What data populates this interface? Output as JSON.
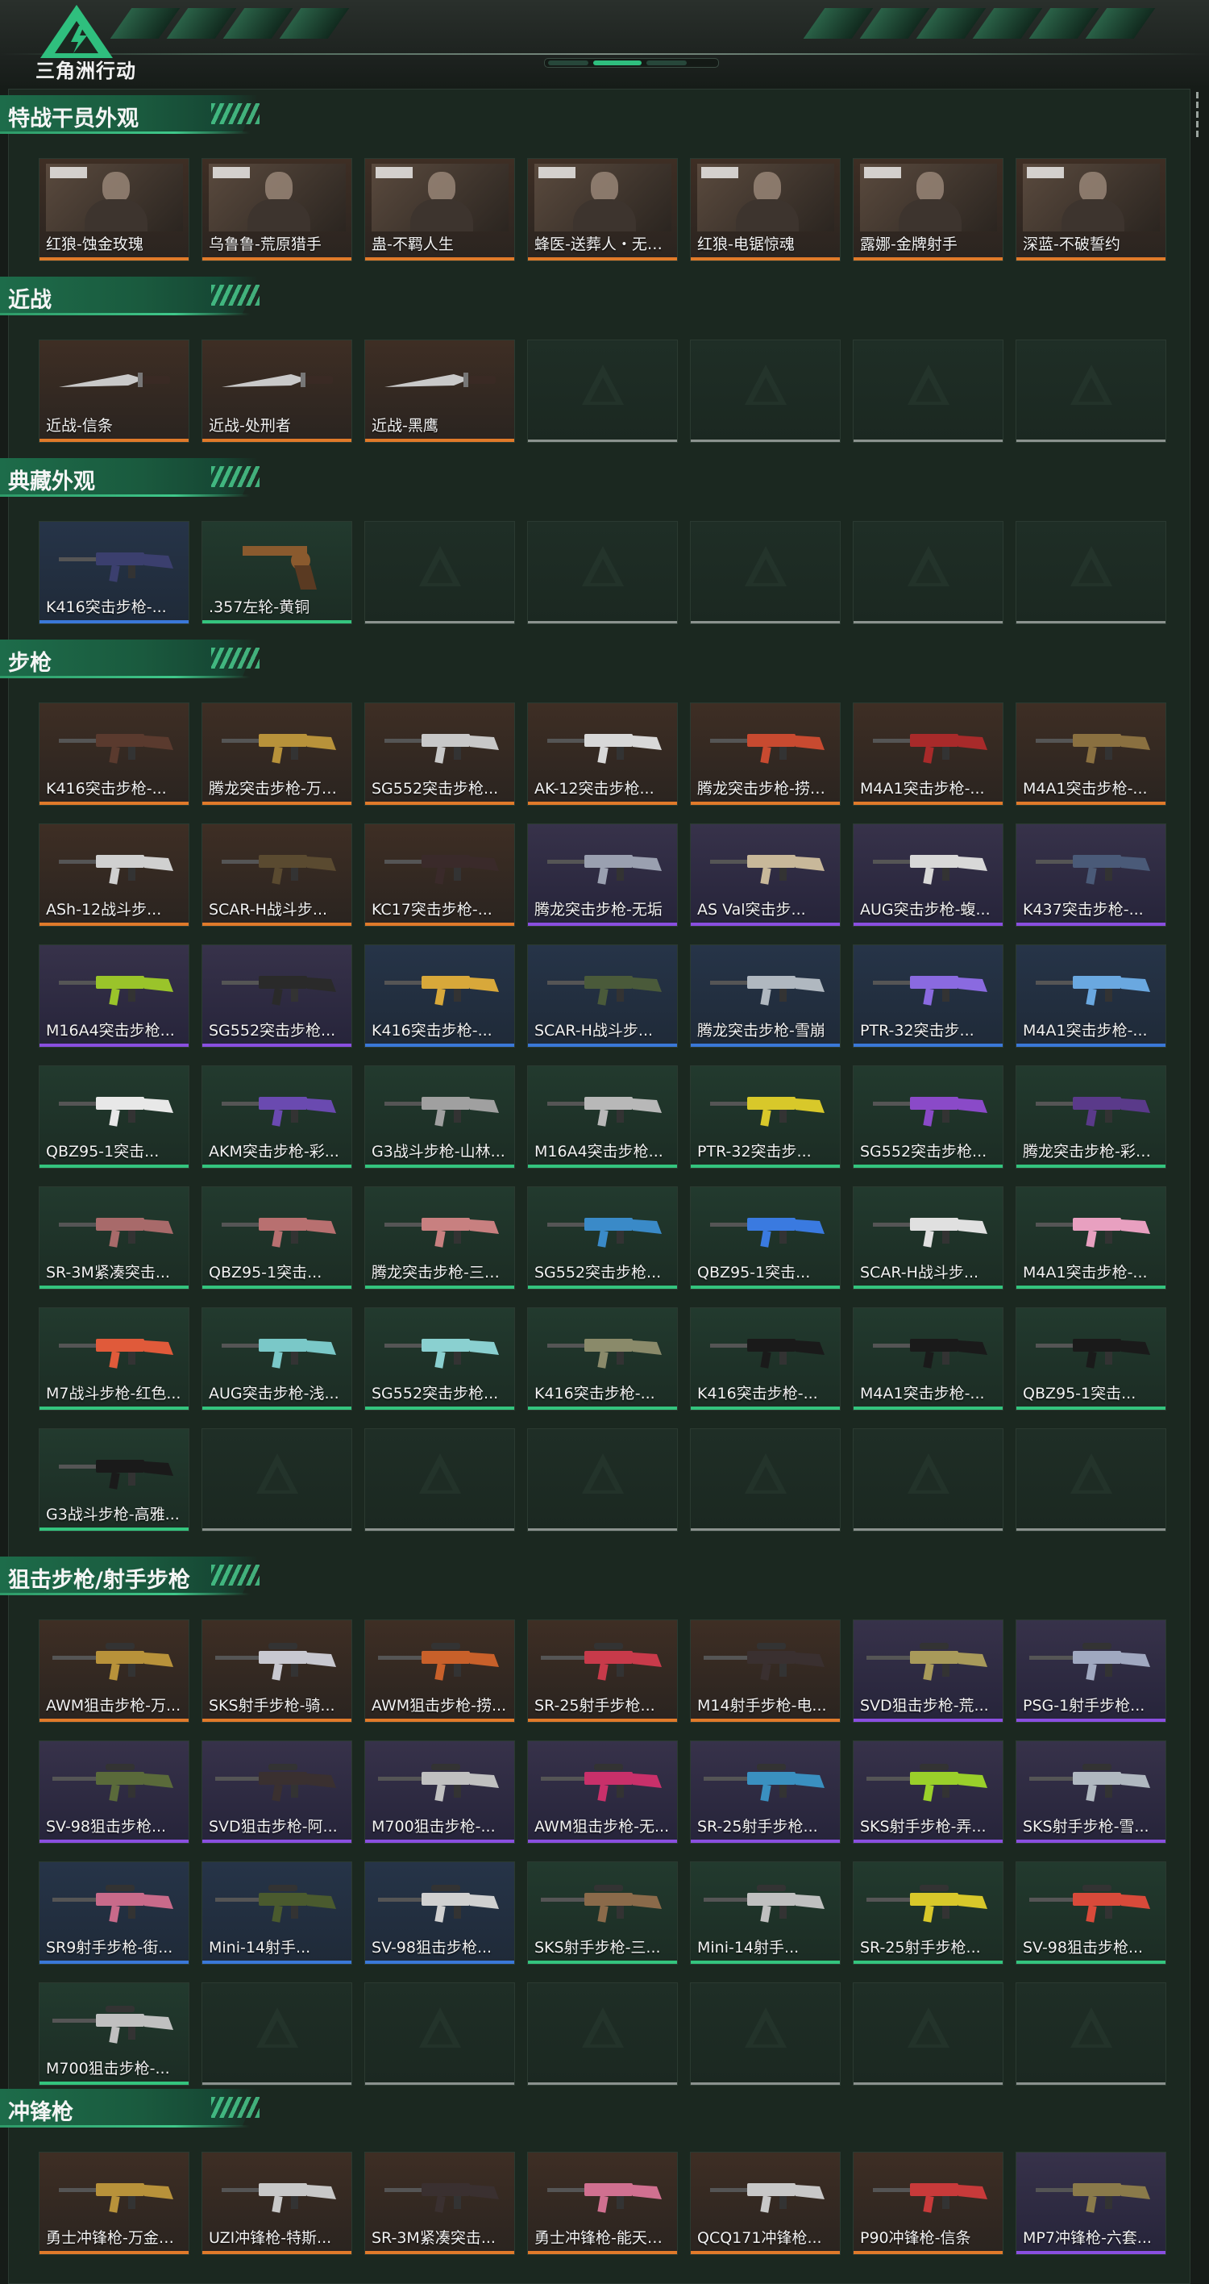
{
  "header": {
    "logo_text": "三角洲行动"
  },
  "colors": {
    "background": "#161c18",
    "panel": "#1b2820",
    "accent_green": "#2fbf7e",
    "quality_orange": "#e07a2a",
    "quality_purple": "#8a4fe0",
    "quality_blue": "#3a78d8",
    "quality_green": "#34c47e",
    "quality_empty": "#8b928e"
  },
  "sections": [
    {
      "title": "特战干员外观",
      "rows": [
        [
          {
            "label": "红狼-蚀金玫瑰",
            "quality": "orange",
            "kind": "operator"
          },
          {
            "label": "乌鲁鲁-荒原猎手",
            "quality": "orange",
            "kind": "operator"
          },
          {
            "label": "蛊-不羁人生",
            "quality": "orange",
            "kind": "operator"
          },
          {
            "label": "蜂医-送葬人・无题...",
            "quality": "orange",
            "kind": "operator"
          },
          {
            "label": "红狼-电锯惊魂",
            "quality": "orange",
            "kind": "operator"
          },
          {
            "label": "露娜-金牌射手",
            "quality": "orange",
            "kind": "operator"
          },
          {
            "label": "深蓝-不破誓约",
            "quality": "orange",
            "kind": "operator"
          }
        ]
      ]
    },
    {
      "title": "近战",
      "rows": [
        [
          {
            "label": "近战-信条",
            "quality": "orange",
            "kind": "melee"
          },
          {
            "label": "近战-处刑者",
            "quality": "orange",
            "kind": "melee"
          },
          {
            "label": "近战-黑鹰",
            "quality": "orange",
            "kind": "melee"
          },
          {
            "label": "",
            "quality": "empty",
            "kind": "empty"
          },
          {
            "label": "",
            "quality": "empty",
            "kind": "empty"
          },
          {
            "label": "",
            "quality": "empty",
            "kind": "empty"
          },
          {
            "label": "",
            "quality": "empty",
            "kind": "empty"
          }
        ]
      ]
    },
    {
      "title": "典藏外观",
      "rows": [
        [
          {
            "label": "K416突击步枪-...",
            "quality": "blue",
            "kind": "rifle",
            "gun_color": "#3b3f6e"
          },
          {
            "label": ".357左轮-黄铜",
            "quality": "green",
            "kind": "pistol",
            "gun_color": "#8a5a2e"
          },
          {
            "label": "",
            "quality": "empty",
            "kind": "empty"
          },
          {
            "label": "",
            "quality": "empty",
            "kind": "empty"
          },
          {
            "label": "",
            "quality": "empty",
            "kind": "empty"
          },
          {
            "label": "",
            "quality": "empty",
            "kind": "empty"
          },
          {
            "label": "",
            "quality": "empty",
            "kind": "empty"
          }
        ]
      ]
    },
    {
      "title": "步枪",
      "rows": [
        [
          {
            "label": "K416突击步枪-...",
            "quality": "orange",
            "kind": "rifle",
            "gun_color": "#5a3a2e"
          },
          {
            "label": "腾龙突击步枪-万金...",
            "quality": "orange",
            "kind": "rifle",
            "gun_color": "#b8923a"
          },
          {
            "label": "SG552突击步枪...",
            "quality": "orange",
            "kind": "rifle",
            "gun_color": "#c8c8c8"
          },
          {
            "label": "AK-12突击步枪...",
            "quality": "orange",
            "kind": "rifle",
            "gun_color": "#d8d8d8"
          },
          {
            "label": "腾龙突击步枪-捞点...",
            "quality": "orange",
            "kind": "rifle",
            "gun_color": "#c84a30"
          },
          {
            "label": "M4A1突击步枪-...",
            "quality": "orange",
            "kind": "rifle",
            "gun_color": "#a82a2a"
          },
          {
            "label": "M4A1突击步枪-...",
            "quality": "orange",
            "kind": "rifle",
            "gun_color": "#8a7040"
          }
        ],
        [
          {
            "label": "ASh-12战斗步...",
            "quality": "orange",
            "kind": "rifle",
            "gun_color": "#d0d0d0"
          },
          {
            "label": "SCAR-H战斗步...",
            "quality": "orange",
            "kind": "rifle",
            "gun_color": "#5a4a30"
          },
          {
            "label": "KC17突击步枪-...",
            "quality": "orange",
            "kind": "rifle",
            "gun_color": "#3a2a2a"
          },
          {
            "label": "腾龙突击步枪-无垢",
            "quality": "purple",
            "kind": "rifle",
            "gun_color": "#9aa0b0"
          },
          {
            "label": "AS Val突击步...",
            "quality": "purple",
            "kind": "rifle",
            "gun_color": "#c8b89a"
          },
          {
            "label": "AUG突击步枪-蝮...",
            "quality": "purple",
            "kind": "rifle",
            "gun_color": "#d8d8d8"
          },
          {
            "label": "K437突击步枪-...",
            "quality": "purple",
            "kind": "rifle",
            "gun_color": "#4a5a78"
          }
        ],
        [
          {
            "label": "M16A4突击步枪...",
            "quality": "purple",
            "kind": "rifle",
            "gun_color": "#9ac42a"
          },
          {
            "label": "SG552突击步枪...",
            "quality": "purple",
            "kind": "rifle",
            "gun_color": "#2a2a2a"
          },
          {
            "label": "K416突击步枪-...",
            "quality": "blue",
            "kind": "rifle",
            "gun_color": "#d8a83a"
          },
          {
            "label": "SCAR-H战斗步...",
            "quality": "blue",
            "kind": "rifle",
            "gun_color": "#4a5a3a"
          },
          {
            "label": "腾龙突击步枪-雪崩",
            "quality": "blue",
            "kind": "rifle",
            "gun_color": "#b0b8c0"
          },
          {
            "label": "PTR-32突击步...",
            "quality": "blue",
            "kind": "rifle",
            "gun_color": "#8a6ae0"
          },
          {
            "label": "M4A1突击步枪-...",
            "quality": "blue",
            "kind": "rifle",
            "gun_color": "#6aa8e0"
          }
        ],
        [
          {
            "label": "QBZ95-1突击...",
            "quality": "green",
            "kind": "rifle",
            "gun_color": "#e8e8e8"
          },
          {
            "label": "AKM突击步枪-彩...",
            "quality": "green",
            "kind": "rifle",
            "gun_color": "#6a4ab0"
          },
          {
            "label": "G3战斗步枪-山林...",
            "quality": "green",
            "kind": "rifle",
            "gun_color": "#a0a0a0"
          },
          {
            "label": "M16A4突击步枪...",
            "quality": "green",
            "kind": "rifle",
            "gun_color": "#b8b8b8"
          },
          {
            "label": "PTR-32突击步...",
            "quality": "green",
            "kind": "rifle",
            "gun_color": "#d8c82a"
          },
          {
            "label": "SG552突击步枪...",
            "quality": "green",
            "kind": "rifle",
            "gun_color": "#8a4ac8"
          },
          {
            "label": "腾龙突击步枪-彩墨...",
            "quality": "green",
            "kind": "rifle",
            "gun_color": "#5a3a8a"
          }
        ],
        [
          {
            "label": "SR-3M紧凑突击...",
            "quality": "green",
            "kind": "rifle",
            "gun_color": "#a86a6a"
          },
          {
            "label": "QBZ95-1突击...",
            "quality": "green",
            "kind": "rifle",
            "gun_color": "#b87070"
          },
          {
            "label": "腾龙突击步枪-三角...",
            "quality": "green",
            "kind": "rifle",
            "gun_color": "#c88080"
          },
          {
            "label": "SG552突击步枪...",
            "quality": "green",
            "kind": "rifle",
            "gun_color": "#3a8ac8"
          },
          {
            "label": "QBZ95-1突击...",
            "quality": "green",
            "kind": "rifle",
            "gun_color": "#3a7ae0"
          },
          {
            "label": "SCAR-H战斗步...",
            "quality": "green",
            "kind": "rifle",
            "gun_color": "#e0e0e0"
          },
          {
            "label": "M4A1突击步枪-...",
            "quality": "green",
            "kind": "rifle",
            "gun_color": "#e8a0c0"
          }
        ],
        [
          {
            "label": "M7战斗步枪-红色...",
            "quality": "green",
            "kind": "rifle",
            "gun_color": "#e05a3a"
          },
          {
            "label": "AUG突击步枪-浅...",
            "quality": "green",
            "kind": "rifle",
            "gun_color": "#7ac8c8"
          },
          {
            "label": "SG552突击步枪...",
            "quality": "green",
            "kind": "rifle",
            "gun_color": "#8ad0d0"
          },
          {
            "label": "K416突击步枪-...",
            "quality": "green",
            "kind": "rifle",
            "gun_color": "#8a8a6a"
          },
          {
            "label": "K416突击步枪-...",
            "quality": "green",
            "kind": "rifle",
            "gun_color": "#1a1a1a"
          },
          {
            "label": "M4A1突击步枪-...",
            "quality": "green",
            "kind": "rifle",
            "gun_color": "#1a1a1a"
          },
          {
            "label": "QBZ95-1突击...",
            "quality": "green",
            "kind": "rifle",
            "gun_color": "#1a1a1a"
          }
        ],
        [
          {
            "label": "G3战斗步枪-高雅...",
            "quality": "green",
            "kind": "rifle",
            "gun_color": "#1a1a1a"
          },
          {
            "label": "",
            "quality": "empty",
            "kind": "empty"
          },
          {
            "label": "",
            "quality": "empty",
            "kind": "empty"
          },
          {
            "label": "",
            "quality": "empty",
            "kind": "empty"
          },
          {
            "label": "",
            "quality": "empty",
            "kind": "empty"
          },
          {
            "label": "",
            "quality": "empty",
            "kind": "empty"
          },
          {
            "label": "",
            "quality": "empty",
            "kind": "empty"
          }
        ]
      ]
    },
    {
      "title": "狙击步枪/射手步枪",
      "rows": [
        [
          {
            "label": "AWM狙击步枪-万...",
            "quality": "orange",
            "kind": "sniper",
            "gun_color": "#b8923a"
          },
          {
            "label": "SKS射手步枪-骑...",
            "quality": "orange",
            "kind": "sniper",
            "gun_color": "#c8c8d0"
          },
          {
            "label": "AWM狙击步枪-捞...",
            "quality": "orange",
            "kind": "sniper",
            "gun_color": "#c8602a"
          },
          {
            "label": "SR-25射手步枪...",
            "quality": "orange",
            "kind": "sniper",
            "gun_color": "#c83a4a"
          },
          {
            "label": "M14射手步枪-电...",
            "quality": "orange",
            "kind": "sniper",
            "gun_color": "#3a3030"
          },
          {
            "label": "SVD狙击步枪-荒...",
            "quality": "purple",
            "kind": "sniper",
            "gun_color": "#a89a5a"
          },
          {
            "label": "PSG-1射手步枪...",
            "quality": "purple",
            "kind": "sniper",
            "gun_color": "#a0a8c0"
          }
        ],
        [
          {
            "label": "SV-98狙击步枪...",
            "quality": "purple",
            "kind": "sniper",
            "gun_color": "#5a6a3a"
          },
          {
            "label": "SVD狙击步枪-阿...",
            "quality": "purple",
            "kind": "sniper",
            "gun_color": "#3a3030"
          },
          {
            "label": "M700狙击步枪-...",
            "quality": "purple",
            "kind": "sniper",
            "gun_color": "#c0c0c0"
          },
          {
            "label": "AWM狙击步枪-无...",
            "quality": "purple",
            "kind": "sniper",
            "gun_color": "#c8306a"
          },
          {
            "label": "SR-25射手步枪...",
            "quality": "purple",
            "kind": "sniper",
            "gun_color": "#3a90c0"
          },
          {
            "label": "SKS射手步枪-弄...",
            "quality": "purple",
            "kind": "sniper",
            "gun_color": "#9ad02a"
          },
          {
            "label": "SKS射手步枪-雪...",
            "quality": "purple",
            "kind": "sniper",
            "gun_color": "#b0b8c0"
          }
        ],
        [
          {
            "label": "SR9射手步枪-街...",
            "quality": "blue",
            "kind": "sniper",
            "gun_color": "#c86a8a"
          },
          {
            "label": "Mini-14射手...",
            "quality": "blue",
            "kind": "sniper",
            "gun_color": "#4a5a2e"
          },
          {
            "label": "SV-98狙击步枪...",
            "quality": "blue",
            "kind": "sniper",
            "gun_color": "#d0d0d0"
          },
          {
            "label": "SKS射手步枪-三...",
            "quality": "green",
            "kind": "sniper",
            "gun_color": "#8a6a4a"
          },
          {
            "label": "Mini-14射手...",
            "quality": "green",
            "kind": "sniper",
            "gun_color": "#c0c0c0"
          },
          {
            "label": "SR-25射手步枪...",
            "quality": "green",
            "kind": "sniper",
            "gun_color": "#d8c82a"
          },
          {
            "label": "SV-98狙击步枪...",
            "quality": "green",
            "kind": "sniper",
            "gun_color": "#d84a3a"
          }
        ],
        [
          {
            "label": "M700狙击步枪-...",
            "quality": "green",
            "kind": "sniper",
            "gun_color": "#c0c0c0"
          },
          {
            "label": "",
            "quality": "empty",
            "kind": "empty"
          },
          {
            "label": "",
            "quality": "empty",
            "kind": "empty"
          },
          {
            "label": "",
            "quality": "empty",
            "kind": "empty"
          },
          {
            "label": "",
            "quality": "empty",
            "kind": "empty"
          },
          {
            "label": "",
            "quality": "empty",
            "kind": "empty"
          },
          {
            "label": "",
            "quality": "empty",
            "kind": "empty"
          }
        ]
      ]
    },
    {
      "title": "冲锋枪",
      "rows": [
        [
          {
            "label": "勇士冲锋枪-万金泪...",
            "quality": "orange",
            "kind": "smg",
            "gun_color": "#b8923a"
          },
          {
            "label": "UZI冲锋枪-特斯...",
            "quality": "orange",
            "kind": "smg",
            "gun_color": "#c8c8c8"
          },
          {
            "label": "SR-3M紧凑突击...",
            "quality": "orange",
            "kind": "smg",
            "gun_color": "#3a3030"
          },
          {
            "label": "勇士冲锋枪-能天使...",
            "quality": "orange",
            "kind": "smg",
            "gun_color": "#d07090"
          },
          {
            "label": "QCQ171冲锋枪...",
            "quality": "orange",
            "kind": "smg",
            "gun_color": "#c8c8c8"
          },
          {
            "label": "P90冲锋枪-信条",
            "quality": "orange",
            "kind": "smg",
            "gun_color": "#c83a3a"
          },
          {
            "label": "MP7冲锋枪-六套...",
            "quality": "purple",
            "kind": "smg",
            "gun_color": "#8a7a4a"
          }
        ]
      ]
    }
  ]
}
